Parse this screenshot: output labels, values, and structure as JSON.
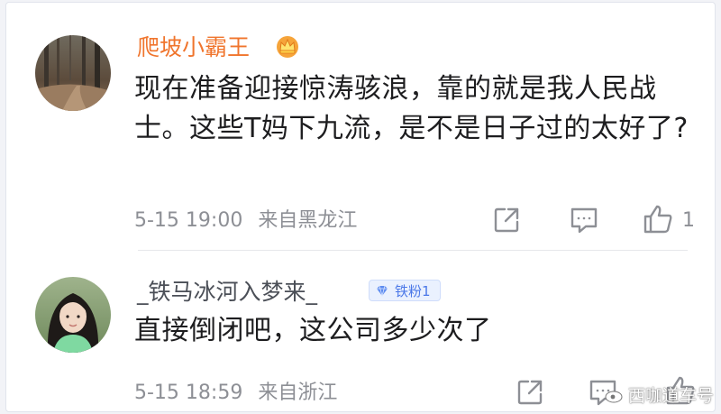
{
  "comments": [
    {
      "username": "爬坡小霸王",
      "text": "现在准备迎接惊涛骇浪，靠的就是我人民战士。这些T妈下九流，是不是日子过的太好了?",
      "time": "5-15 19:00",
      "location": "来自黑龙江",
      "likes": "1",
      "username_color": "#f0752d",
      "has_crown": true
    },
    {
      "username": "_铁马冰河入梦来_",
      "badge": "铁粉1",
      "text": "直接倒闭吧，这公司多少次了",
      "time": "5-15 18:59",
      "location": "来自浙江",
      "likes": ""
    }
  ],
  "watermark": "西咖道车号",
  "colors": {
    "accent_orange": "#f0752d",
    "meta_gray": "#8d8f95",
    "badge_blue": "#4b78e8"
  }
}
